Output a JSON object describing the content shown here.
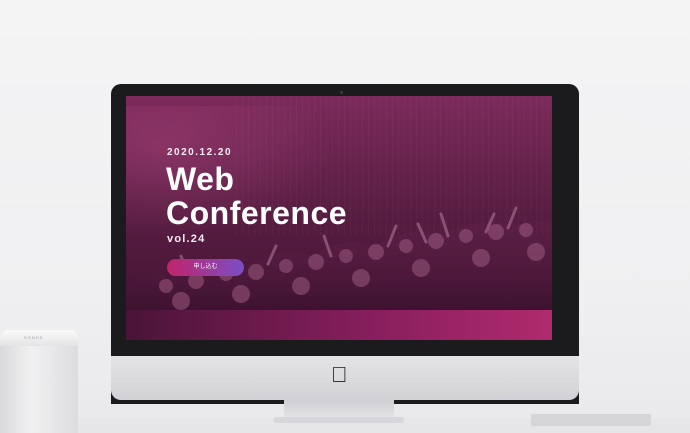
{
  "hero": {
    "date": "2020.12.20",
    "title_line1": "Web",
    "title_line2": "Conference",
    "vol": "vol.24",
    "cta_label": "申し込む"
  },
  "speaker": {
    "brand": "SONOS"
  },
  "device": {
    "logo_icon": "apple-icon"
  },
  "colors": {
    "screen_top": "#7c2a5b",
    "screen_bottom": "#3e1130",
    "cta_start": "#c1246a",
    "cta_end": "#7a4ec7"
  }
}
